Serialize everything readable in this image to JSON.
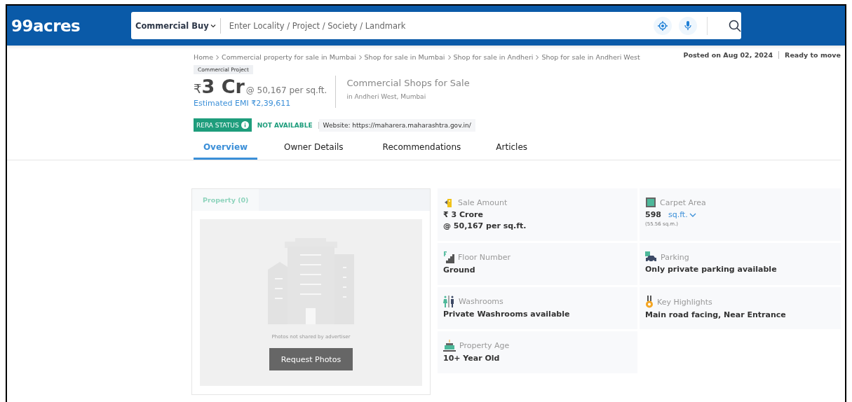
{
  "header": {
    "logo": "99acres",
    "category": "Commercial Buy",
    "search_placeholder": "Enter Locality / Project / Society / Landmark"
  },
  "breadcrumbs": [
    "Home",
    "Commercial property for sale in Mumbai",
    "Shop for sale in Mumbai",
    "Shop for sale in Andheri",
    "Shop for sale in Andheri West"
  ],
  "meta": {
    "posted": "Posted on Aug 02, 2024",
    "status": "Ready to move"
  },
  "badge": "Commercial Project",
  "price": {
    "currency": "₹",
    "amount": "3 Cr",
    "rate": "@ 50,167 per sq.ft.",
    "emi": "Estimated EMI ₹2,39,611"
  },
  "title": {
    "heading": "Commercial Shops for Sale",
    "location": "in Andheri West, Mumbai"
  },
  "rera": {
    "label": "RERA STATUS",
    "value": "NOT AVAILABLE",
    "website": "Website: https://maharera.maharashtra.gov.in/"
  },
  "tabs": [
    {
      "label": "Overview",
      "selected": true
    },
    {
      "label": "Owner Details",
      "selected": false
    },
    {
      "label": "Recommendations",
      "selected": false
    },
    {
      "label": "Articles",
      "selected": false
    }
  ],
  "gallery": {
    "tabs": [
      {
        "label": "Property (0)",
        "selected": true
      }
    ],
    "note": "Photos not shared by advertiser",
    "button": "Request Photos"
  },
  "details": [
    {
      "kind": "sale",
      "label": "Sale Amount",
      "value": "₹ 3 Crore",
      "sub": "@ 50,167 per sq.ft."
    },
    {
      "kind": "area",
      "label": "Carpet Area",
      "value": "598",
      "unit": "sq.ft.",
      "note": "(55.56 sq.m.)"
    },
    {
      "kind": "floor",
      "label": "Floor Number",
      "value": "Ground"
    },
    {
      "kind": "parking",
      "label": "Parking",
      "value": "Only private parking available"
    },
    {
      "kind": "washroom",
      "label": "Washrooms",
      "value": "Private Washrooms available"
    },
    {
      "kind": "highlight",
      "label": "Key Highlights",
      "value": "Main road facing, Near Entrance"
    },
    {
      "kind": "age",
      "label": "Property Age",
      "value": "10+ Year Old"
    }
  ]
}
